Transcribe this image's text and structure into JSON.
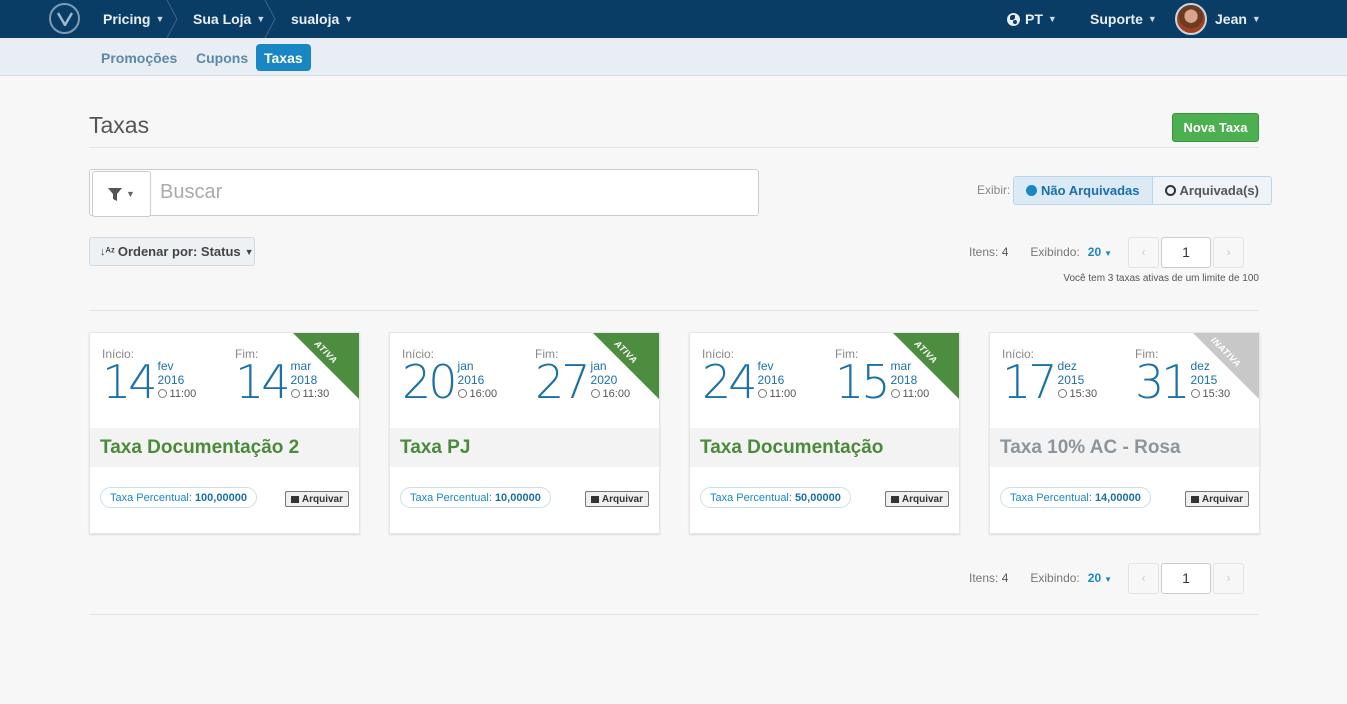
{
  "topbar": {
    "crumbs": [
      "Pricing",
      "Sua Loja",
      "sualoja"
    ],
    "language": "PT",
    "support": "Suporte",
    "user": "Jean"
  },
  "subnav": {
    "tabs": [
      "Promoções",
      "Cupons",
      "Taxas"
    ],
    "active": "Taxas"
  },
  "header": {
    "title": "Taxas",
    "new_button": "Nova Taxa"
  },
  "search": {
    "placeholder": "Buscar"
  },
  "filter": {
    "label": "Exibir:",
    "options": [
      "Não Arquivadas",
      "Arquivada(s)"
    ],
    "selected": "Não Arquivadas"
  },
  "sort": {
    "label": "Ordenar por: Status"
  },
  "pagination": {
    "items_label": "Itens:",
    "items_count": "4",
    "showing_label": "Exibindo:",
    "per_page": "20",
    "page": "1",
    "limit_note": "Você tem 3 taxas ativas de um limite de 100"
  },
  "cards": [
    {
      "status": "ATIVA",
      "start": {
        "label": "Início:",
        "day": "14",
        "month": "fev",
        "year": "2016",
        "time": "11:00"
      },
      "end": {
        "label": "Fim:",
        "day": "14",
        "month": "mar",
        "year": "2018",
        "time": "11:30"
      },
      "title": "Taxa Documentação 2",
      "rate_label": "Taxa Percentual:",
      "rate_value": "100,00000",
      "archive": "Arquivar"
    },
    {
      "status": "ATIVA",
      "start": {
        "label": "Início:",
        "day": "20",
        "month": "jan",
        "year": "2016",
        "time": "16:00"
      },
      "end": {
        "label": "Fim:",
        "day": "27",
        "month": "jan",
        "year": "2020",
        "time": "16:00"
      },
      "title": "Taxa PJ",
      "rate_label": "Taxa Percentual:",
      "rate_value": "10,00000",
      "archive": "Arquivar"
    },
    {
      "status": "ATIVA",
      "start": {
        "label": "Início:",
        "day": "24",
        "month": "fev",
        "year": "2016",
        "time": "11:00"
      },
      "end": {
        "label": "Fim:",
        "day": "15",
        "month": "mar",
        "year": "2018",
        "time": "11:00"
      },
      "title": "Taxa Documentação",
      "rate_label": "Taxa Percentual:",
      "rate_value": "50,00000",
      "archive": "Arquivar"
    },
    {
      "status": "INATIVA",
      "start": {
        "label": "Início:",
        "day": "17",
        "month": "dez",
        "year": "2015",
        "time": "15:30"
      },
      "end": {
        "label": "Fim:",
        "day": "31",
        "month": "dez",
        "year": "2015",
        "time": "15:30"
      },
      "title": "Taxa 10% AC - Rosa",
      "rate_label": "Taxa Percentual:",
      "rate_value": "14,00000",
      "archive": "Arquivar"
    }
  ],
  "colors": {
    "topbar": "#0a3d66",
    "accent": "#1a87c5",
    "active_green": "#4c8d3f",
    "inactive_gray": "#c8c8c8"
  }
}
